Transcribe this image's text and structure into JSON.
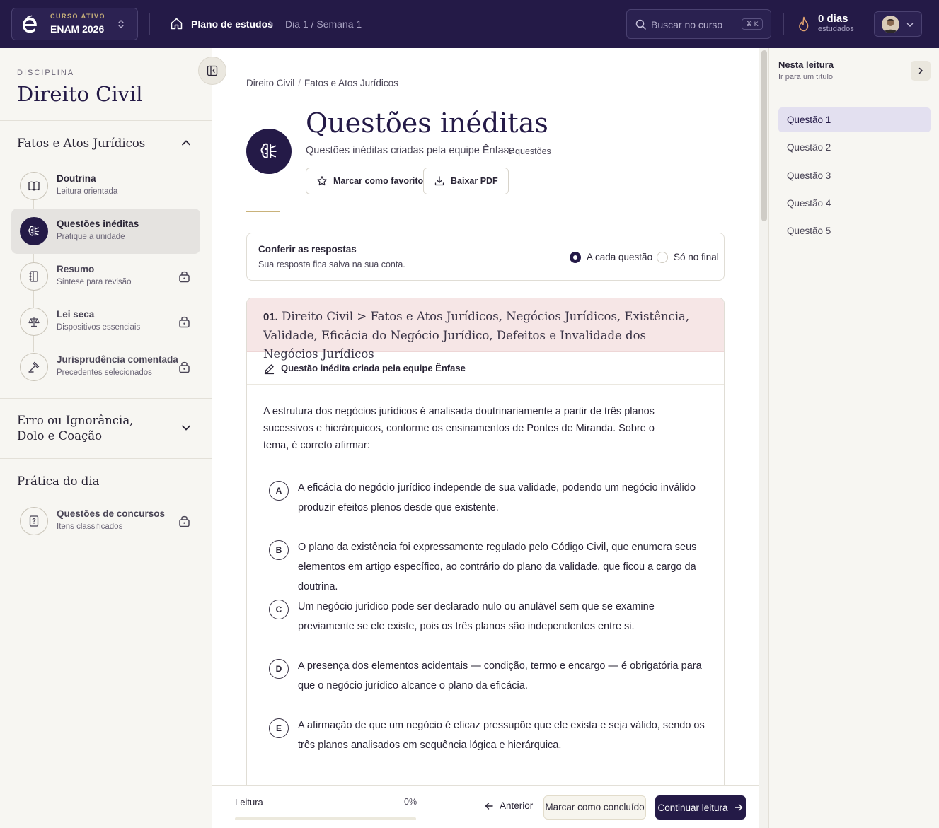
{
  "topbar": {
    "course_kicker": "CURSO ATIVO",
    "course_name": "ENAM 2026",
    "breadcrumb_plan": "Plano de estudos",
    "breadcrumb_day": "Dia 1 / Semana 1",
    "search_placeholder": "Buscar no curso",
    "search_shortcut": "⌘ K",
    "streak_value": "0 dias",
    "streak_label": "estudados"
  },
  "sidebar": {
    "kicker": "DISCIPLINA",
    "title": "Direito Civil",
    "section1": {
      "title": "Fatos e Atos Jurídicos",
      "items": [
        {
          "title": "Doutrina",
          "subtitle": "Leitura orientada",
          "icon": "book-icon",
          "locked": false
        },
        {
          "title": "Questões inéditas",
          "subtitle": "Pratique a unidade",
          "icon": "brain-icon",
          "locked": false,
          "active": true
        },
        {
          "title": "Resumo",
          "subtitle": "Síntese para revisão",
          "icon": "notebook-icon",
          "locked": true
        },
        {
          "title": "Lei seca",
          "subtitle": "Dispositivos essenciais",
          "icon": "scale-icon",
          "locked": true
        },
        {
          "title": "Jurisprudência comentada",
          "subtitle": "Precedentes selecionados",
          "icon": "gavel-icon",
          "locked": true
        }
      ]
    },
    "section2": {
      "title": "Erro ou Ignorância, Dolo e Coação"
    },
    "section3": {
      "title": "Prática do dia",
      "items": [
        {
          "title": "Questões de concursos",
          "subtitle": "Itens classificados",
          "icon": "question-file-icon",
          "locked": true
        }
      ]
    }
  },
  "main": {
    "breadcrumb": [
      "Direito Civil",
      "Fatos e Atos Jurídicos"
    ],
    "title": "Questões inéditas",
    "subtitle": "Questões inéditas criadas pela equipe Ênfase",
    "count": "· 5 questões",
    "favorite_label": "Marcar como favorito",
    "pdf_label": "Baixar PDF",
    "check": {
      "title": "Conferir as respostas",
      "subtitle": "Sua resposta fica salva na sua conta.",
      "option_each": "A cada questão",
      "option_end": "Só no final",
      "selected": "each"
    },
    "question": {
      "number": "01.",
      "topic": "Direito Civil > Fatos e Atos Jurídicos, Negócios Jurídicos, Existência, Validade, Eficácia do Negócio Jurídico, Defeitos e Invalidade dos Negócios Jurídicos",
      "author": "Questão inédita criada pela equipe Ênfase",
      "stem": "A estrutura dos negócios jurídicos é analisada doutrinariamente a partir de três planos sucessivos e hierárquicos, conforme os ensinamentos de Pontes de Miranda. Sobre o tema, é correto afirmar:",
      "options": [
        {
          "letter": "A",
          "text": "A eficácia do negócio jurídico independe de sua validade, podendo um negócio inválido produzir efeitos plenos desde que existente."
        },
        {
          "letter": "B",
          "text": "O plano da existência foi expressamente regulado pelo Código Civil, que enumera seus elementos em artigo específico, ao contrário do plano da validade, que ficou a cargo da doutrina."
        },
        {
          "letter": "C",
          "text": "Um negócio jurídico pode ser declarado nulo ou anulável sem que se examine previamente se ele existe, pois os três planos são independentes entre si."
        },
        {
          "letter": "D",
          "text": "A presença dos elementos acidentais — condição, termo e encargo — é obrigatória para que o negócio jurídico alcance o plano da eficácia."
        },
        {
          "letter": "E",
          "text": "A afirmação de que um negócio é eficaz pressupõe que ele exista e seja válido, sendo os três planos analisados em sequência lógica e hierárquica."
        }
      ]
    }
  },
  "bottombar": {
    "label": "Leitura",
    "percent": "0%",
    "progress": 0,
    "prev_label": "Anterior",
    "done_label": "Marcar como concluído",
    "next_label": "Continuar leitura"
  },
  "toc": {
    "title": "Nesta leitura",
    "subtitle": "Ir para um título",
    "items": [
      "Questão 1",
      "Questão 2",
      "Questão 3",
      "Questão 4",
      "Questão 5"
    ],
    "active_index": 0
  },
  "colors": {
    "brand": "#241a47",
    "gold": "#c9b27a",
    "question_header": "#f6e6e6"
  }
}
